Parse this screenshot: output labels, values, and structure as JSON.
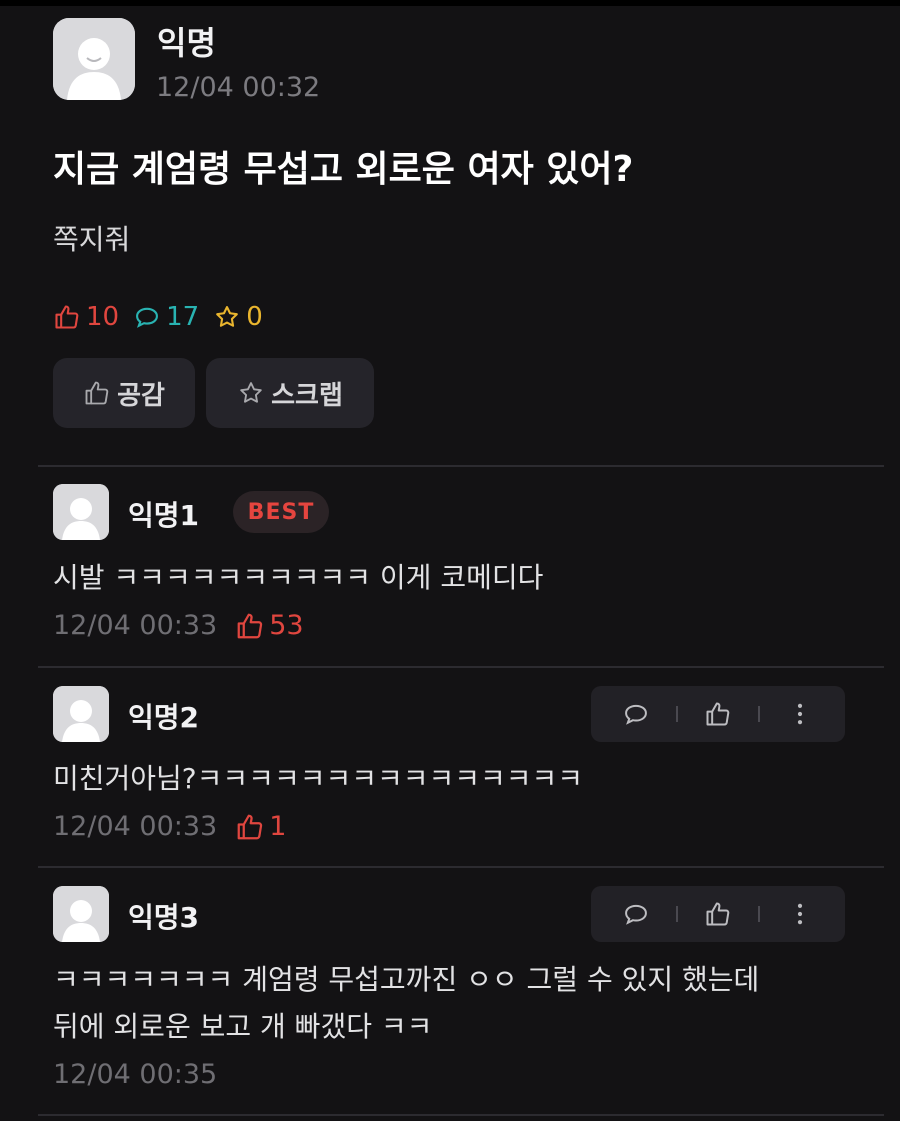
{
  "post": {
    "author": "익명",
    "time": "12/04 00:32",
    "title": "지금 계엄령 무섭고 외로운 여자 있어?",
    "body": "쪽지줘",
    "stats": {
      "likes": "10",
      "comments": "17",
      "scraps": "0"
    },
    "buttons": {
      "empathy": "공감",
      "scrap": "스크랩"
    }
  },
  "comments": [
    {
      "author": "익명1",
      "badge": "BEST",
      "text": "시발 ㅋㅋㅋㅋㅋㅋㅋㅋㅋㅋ 이게 코메디다",
      "time": "12/04 00:33",
      "likes": "53"
    },
    {
      "author": "익명2",
      "text": "미친거아님?ㅋㅋㅋㅋㅋㅋㅋㅋㅋㅋㅋㅋㅋㅋㅋ",
      "time": "12/04 00:33",
      "likes": "1"
    },
    {
      "author": "익명3",
      "text_line1": "ㅋㅋㅋㅋㅋㅋㅋ 계엄령 무섭고까진 ㅇㅇ 그럴 수 있지 했는데",
      "text_line2": "뒤에 외로운 보고 개 빠갰다 ㅋㅋ",
      "time": "12/04 00:35"
    }
  ],
  "colors": {
    "background": "#131214",
    "like": "#e0463f",
    "comment": "#29b3b2",
    "scrap": "#e9b52e",
    "badge": "#e5453f"
  },
  "icons": [
    "thumbs-up-icon",
    "speech-bubble-icon",
    "star-icon",
    "more-vertical-icon",
    "avatar-icon"
  ]
}
